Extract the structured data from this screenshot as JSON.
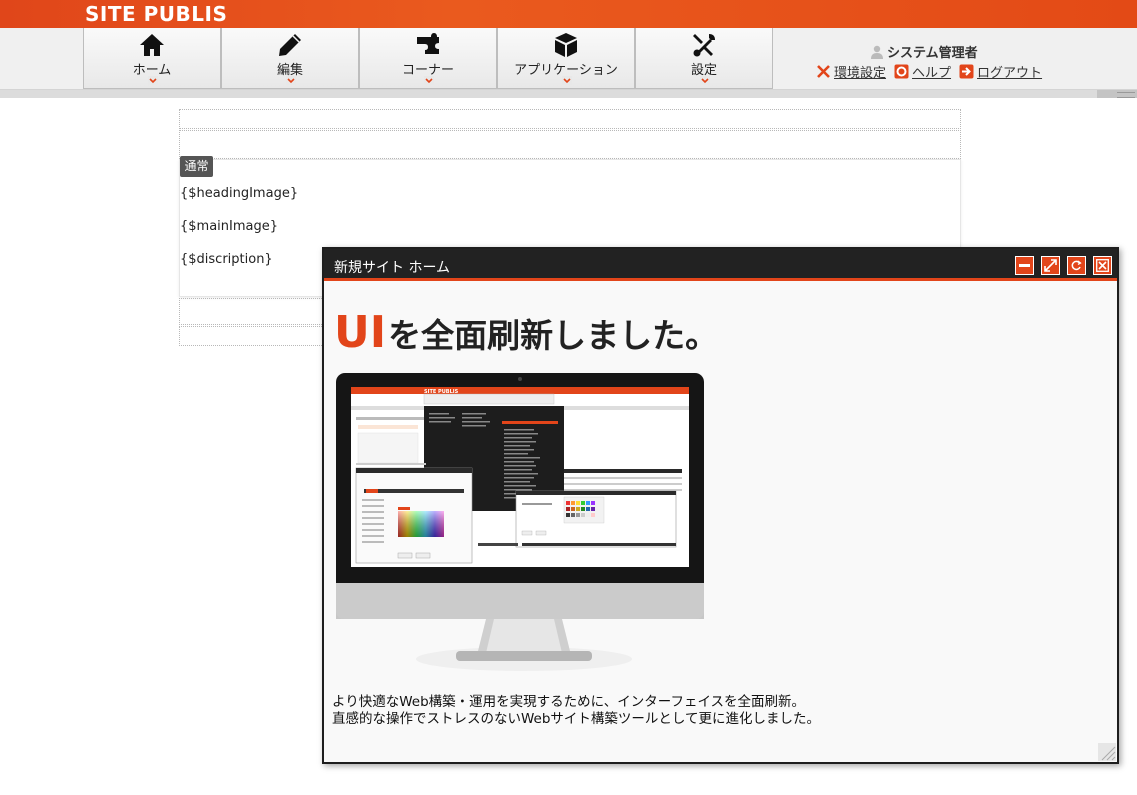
{
  "header": {
    "logo": "SITE PUBLIS",
    "brand_color": "#e2451a"
  },
  "nav": {
    "items": [
      {
        "label": "ホーム",
        "icon": "home-icon"
      },
      {
        "label": "編集",
        "icon": "pencil-icon"
      },
      {
        "label": "コーナー",
        "icon": "puzzle-icon"
      },
      {
        "label": "アプリケーション",
        "icon": "cube-icon"
      },
      {
        "label": "設定",
        "icon": "tools-icon"
      }
    ]
  },
  "user": {
    "name": "システム管理者",
    "links": [
      {
        "label": "環境設定",
        "icon": "wrench-icon"
      },
      {
        "label": "ヘルプ",
        "icon": "help-icon"
      },
      {
        "label": "ログアウト",
        "icon": "logout-icon"
      }
    ]
  },
  "content": {
    "badge": "通常",
    "placeholders": [
      "{$headingImage}",
      "{$mainImage}",
      "{$discription}"
    ]
  },
  "popup": {
    "title": "新規サイト ホーム",
    "headline_accent": "UI",
    "headline_rest": "を全面刷新しました。",
    "screen_logo": "SITE PUBLIS",
    "description_lines": [
      "より快適なWeb構築・運用を実現するために、インターフェイスを全面刷新。",
      "直感的な操作でストレスのないWebサイト構築ツールとして更に進化しました。"
    ]
  }
}
